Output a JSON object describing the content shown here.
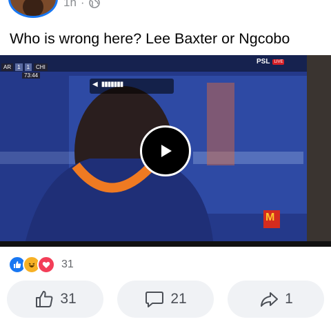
{
  "post": {
    "time": "1h",
    "separator": "·",
    "text": "Who is wrong here? Lee Baxter or Ngcobo"
  },
  "video": {
    "scoreboard": {
      "home": "AR",
      "home_score": "1",
      "away_score": "1",
      "away": "CHI",
      "clock": "73:44"
    },
    "channel": "PSL",
    "live_badge": "LIVE",
    "volume_icon": "speaker-icon",
    "sponsor_logo": "M"
  },
  "reactions": {
    "icons": [
      "like-reaction-icon",
      "haha-reaction-icon",
      "love-reaction-icon"
    ],
    "count": "31"
  },
  "actions": {
    "like_count": "31",
    "comment_count": "21",
    "share_count": "1"
  }
}
